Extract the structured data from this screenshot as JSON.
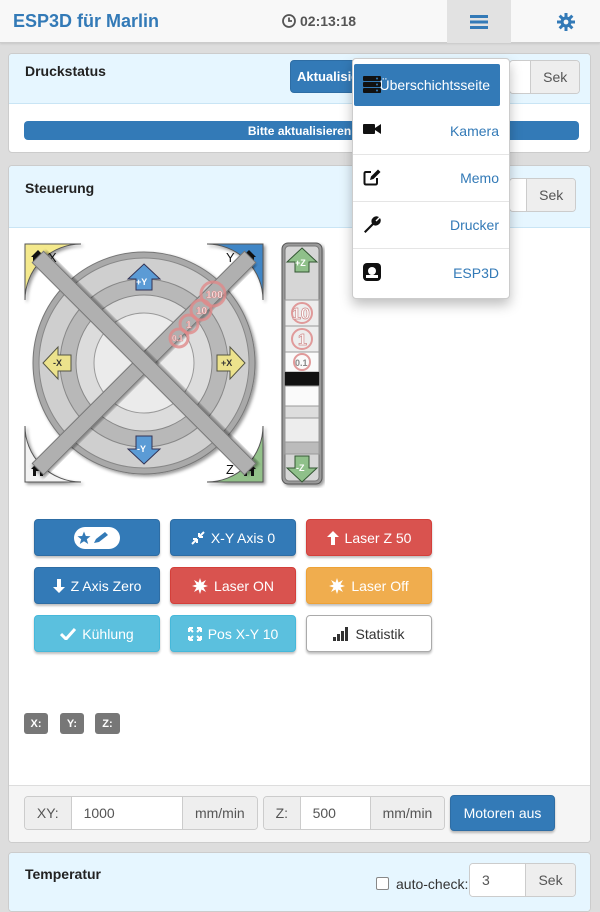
{
  "navbar": {
    "brand": "ESP3D für Marlin",
    "clock": "02:13:18",
    "menu_icon": "hamburger-icon",
    "settings_icon": "gear-icon"
  },
  "status_panel": {
    "title": "Druckstatus",
    "refresh_label": "Aktualisieren",
    "interval_unit": "Sek",
    "progress_text": "Bitte aktualisieren!"
  },
  "control_panel": {
    "title": "Steuerung",
    "interval_unit": "Sek",
    "jog": {
      "home_x": "X",
      "home_y": "Y",
      "home_z": "Z",
      "plus_y": "+Y",
      "minus_y": "-Y",
      "plus_x": "+X",
      "minus_x": "-X",
      "plus_z": "+Z",
      "minus_z": "-Z",
      "step_100": "100",
      "step_10": "10",
      "step_1": "1",
      "step_01": "0.1",
      "z_10": "10",
      "z_1": "1",
      "z_01": "0.1"
    },
    "macros": [
      {
        "label": "",
        "color": "blue",
        "icon": "star-pencil-icon"
      },
      {
        "label": "X-Y Axis 0",
        "color": "blue",
        "icon": "compress-icon"
      },
      {
        "label": "Laser Z 50",
        "color": "red",
        "icon": "arrow-up-icon"
      },
      {
        "label": "Z Axis Zero",
        "color": "blue",
        "icon": "arrow-down-icon"
      },
      {
        "label": "Laser ON",
        "color": "red",
        "icon": "burst-icon"
      },
      {
        "label": "Laser Off",
        "color": "orange",
        "icon": "burst-icon"
      },
      {
        "label": "Kühlung",
        "color": "cyan",
        "icon": "check-icon"
      },
      {
        "label": "Pos X-Y 10",
        "color": "cyan",
        "icon": "expand-icon"
      },
      {
        "label": "Statistik",
        "color": "white",
        "icon": "signal-icon"
      }
    ],
    "coords": {
      "x": "X:",
      "y": "Y:",
      "z": "Z:"
    },
    "feedrate": {
      "xy_label": "XY:",
      "xy_value": "1000",
      "xy_unit": "mm/min",
      "z_label": "Z:",
      "z_value": "500",
      "z_unit": "mm/min",
      "motors_off": "Motoren aus"
    }
  },
  "temp_panel": {
    "title": "Temperatur",
    "autocheck_label": "auto-check:",
    "interval_value": "3",
    "interval_unit": "Sek"
  },
  "dropdown": {
    "items": [
      {
        "label": "Überschichtsseite",
        "icon": "server-icon",
        "active": true
      },
      {
        "label": "Kamera",
        "icon": "video-camera-icon"
      },
      {
        "label": "Memo",
        "icon": "edit-icon"
      },
      {
        "label": "Drucker",
        "icon": "wrench-icon"
      },
      {
        "label": "ESP3D",
        "icon": "esp-logo-icon"
      }
    ]
  },
  "colors": {
    "primary": "#337ab7",
    "danger": "#d9534f",
    "warning": "#f0ad4e",
    "info": "#5bc0de",
    "panel_head": "#e6f6ff"
  }
}
